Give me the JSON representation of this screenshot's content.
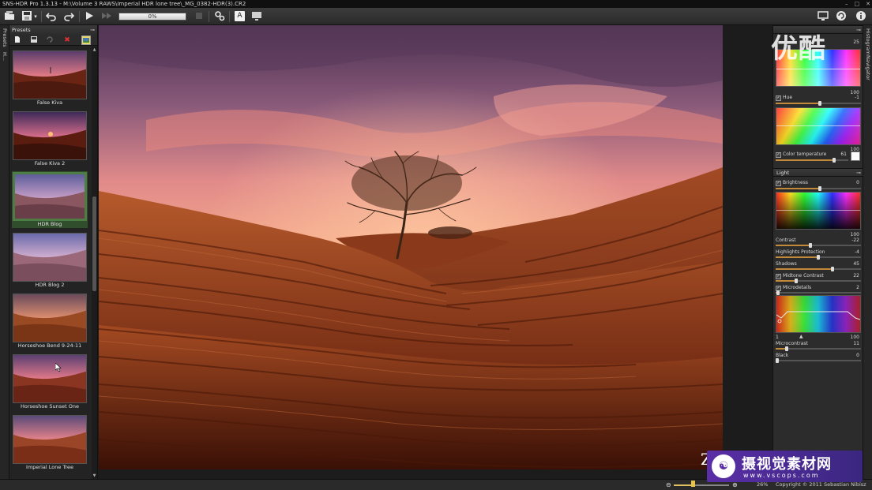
{
  "window": {
    "title": "SNS-HDR Pro 1.3.13 - M:\\Volume 3 RAWS\\Imperial HDR lone tree\\_MG_0382-HDR(3).CR2",
    "controls": [
      "–",
      "□",
      "✕"
    ]
  },
  "toolbar": {
    "progress_text": "0%",
    "progress": 0.0,
    "icons": [
      "open-folder-icon",
      "save-icon",
      "dropdown-arrow-icon",
      "undo-icon",
      "redo-icon",
      "play-icon",
      "fast-forward-icon",
      "stop-icon",
      "settings-icon",
      "text-a-icon",
      "monitor-icon",
      "display-icon",
      "refresh-icon",
      "info-icon"
    ]
  },
  "left_tabs": [
    "Presets",
    "H..."
  ],
  "presets": {
    "header": "Presets",
    "items": [
      {
        "label": "False Kiva",
        "selected": false
      },
      {
        "label": "False Kiva 2",
        "selected": false
      },
      {
        "label": "HDR Blog",
        "selected": true
      },
      {
        "label": "HDR Blog 2",
        "selected": false
      },
      {
        "label": "Horseshoe Bend 9-24-11",
        "selected": false
      },
      {
        "label": "Horseshoe Sunset One",
        "selected": false
      },
      {
        "label": "Imperial Lone Tree",
        "selected": false
      }
    ]
  },
  "right_tabs": [
    "Histogram",
    "Navigator"
  ],
  "adjustments": {
    "color": {
      "top_value": "25",
      "hue_label": "Hue",
      "hue_max": "100",
      "hue_value": "-1",
      "colortemp_max": "100",
      "colortemp_label": "Color temperature",
      "colortemp_value": "61"
    },
    "light": {
      "header": "Light",
      "brightness_label": "Brightness",
      "brightness_value": "0",
      "contrast_max": "100",
      "contrast_label": "Contrast",
      "contrast_value": "-22",
      "highlights_label": "Highlights Protection",
      "highlights_value": "-4",
      "shadows_label": "Shadows",
      "shadows_value": "45",
      "midtone_label": "Midtone Contrast",
      "midtone_value": "22",
      "microdetails_label": "Microdetails",
      "microdetails_value": "2",
      "curve_min": "1",
      "curve_max": "100",
      "microcontrast_label": "Microcontrast",
      "microcontrast_value": "11",
      "black_label": "Black",
      "black_value": "0"
    }
  },
  "status": {
    "zoom_percent": "26%",
    "copyright": "Copyright © 2011 Sebastian Nibisz"
  },
  "overlays": {
    "top_right_watermark": "优酷",
    "bottom_right_cn": "摄视觉素材网",
    "bottom_right_url": "www.vscops.com",
    "zoom_glyph": "Z"
  }
}
